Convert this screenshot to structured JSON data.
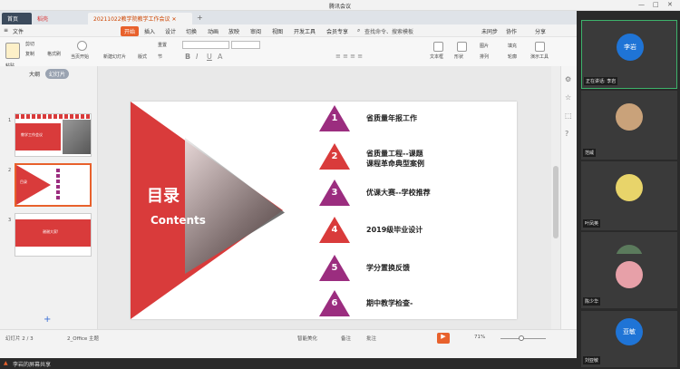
{
  "window": {
    "title": "腾讯会议"
  },
  "tabs": {
    "home": "首页",
    "shell": "稻壳",
    "doc": "20211022教学院教学工作会议",
    "add": "+"
  },
  "menu": [
    "文件",
    "开始",
    "插入",
    "设计",
    "切换",
    "动画",
    "放映",
    "审阅",
    "视图",
    "开发工具",
    "会员专享"
  ],
  "menu_search": "查找命令、搜索模板",
  "menu_right": {
    "collab": "未同步",
    "cooperate": "协作",
    "share": "分享"
  },
  "toolbar": {
    "cut": "剪切",
    "copy": "复制",
    "painter": "格式刷",
    "paste": "粘贴",
    "play": "当页开始",
    "new_slide": "新建幻灯片",
    "layout": "版式",
    "section": "节",
    "reset": "重置",
    "textbox": "文本框",
    "shape": "形状",
    "arrange": "排列",
    "picture": "图片",
    "fill": "填充",
    "outline": "轮廓",
    "present_tool": "演示工具"
  },
  "panel": {
    "tab_outline": "大纲",
    "tab_thumbs": "幻灯片",
    "add": "+"
  },
  "thumbs": [
    {
      "num": "1",
      "title": "教学工作会议"
    },
    {
      "num": "2",
      "title": "目录"
    },
    {
      "num": "3",
      "title": "谢谢大家!"
    }
  ],
  "slide": {
    "title": "目录",
    "subtitle": "Contents",
    "items": [
      {
        "num": "1",
        "label": "省质量年报工作",
        "color": "#9b2d7f"
      },
      {
        "num": "2",
        "label": "省质量工程--课题\n课程革命典型案例",
        "color": "#d93b3b"
      },
      {
        "num": "3",
        "label": "优课大赛--学校推荐",
        "color": "#9b2d7f"
      },
      {
        "num": "4",
        "label": "2019级毕业设计",
        "color": "#d93b3b"
      },
      {
        "num": "5",
        "label": "学分置换反馈",
        "color": "#9b2d7f"
      },
      {
        "num": "6",
        "label": "期中教学检查-",
        "color": "#9b2d7f"
      }
    ]
  },
  "statusbar": {
    "page": "幻灯片 2 / 3",
    "theme": "2_Office 主题",
    "smart": "智能美化",
    "notes": "备注",
    "comment": "批注",
    "zoom": "71%"
  },
  "share": {
    "text": "李岩的屏幕共享"
  },
  "participants": [
    {
      "name": "正在讲话: 李岩",
      "avatar": "李岩",
      "color": "#1f74d6"
    },
    {
      "name": "范威",
      "avatar": "",
      "color": "#c9a27a"
    },
    {
      "name": "叶凤英",
      "avatar": "",
      "color": "#e8d46a"
    },
    {
      "name": "郭建",
      "avatar": "",
      "color": "#5b7a5c"
    },
    {
      "name": "陈少华",
      "avatar": "",
      "color": "#e7a0a8"
    },
    {
      "name": "刘亚敏",
      "avatar": "亚敏",
      "color": "#1f74d6"
    }
  ],
  "colors": {
    "accent": "#e8612c",
    "red": "#d93b3b",
    "purple": "#9b2d7f"
  }
}
